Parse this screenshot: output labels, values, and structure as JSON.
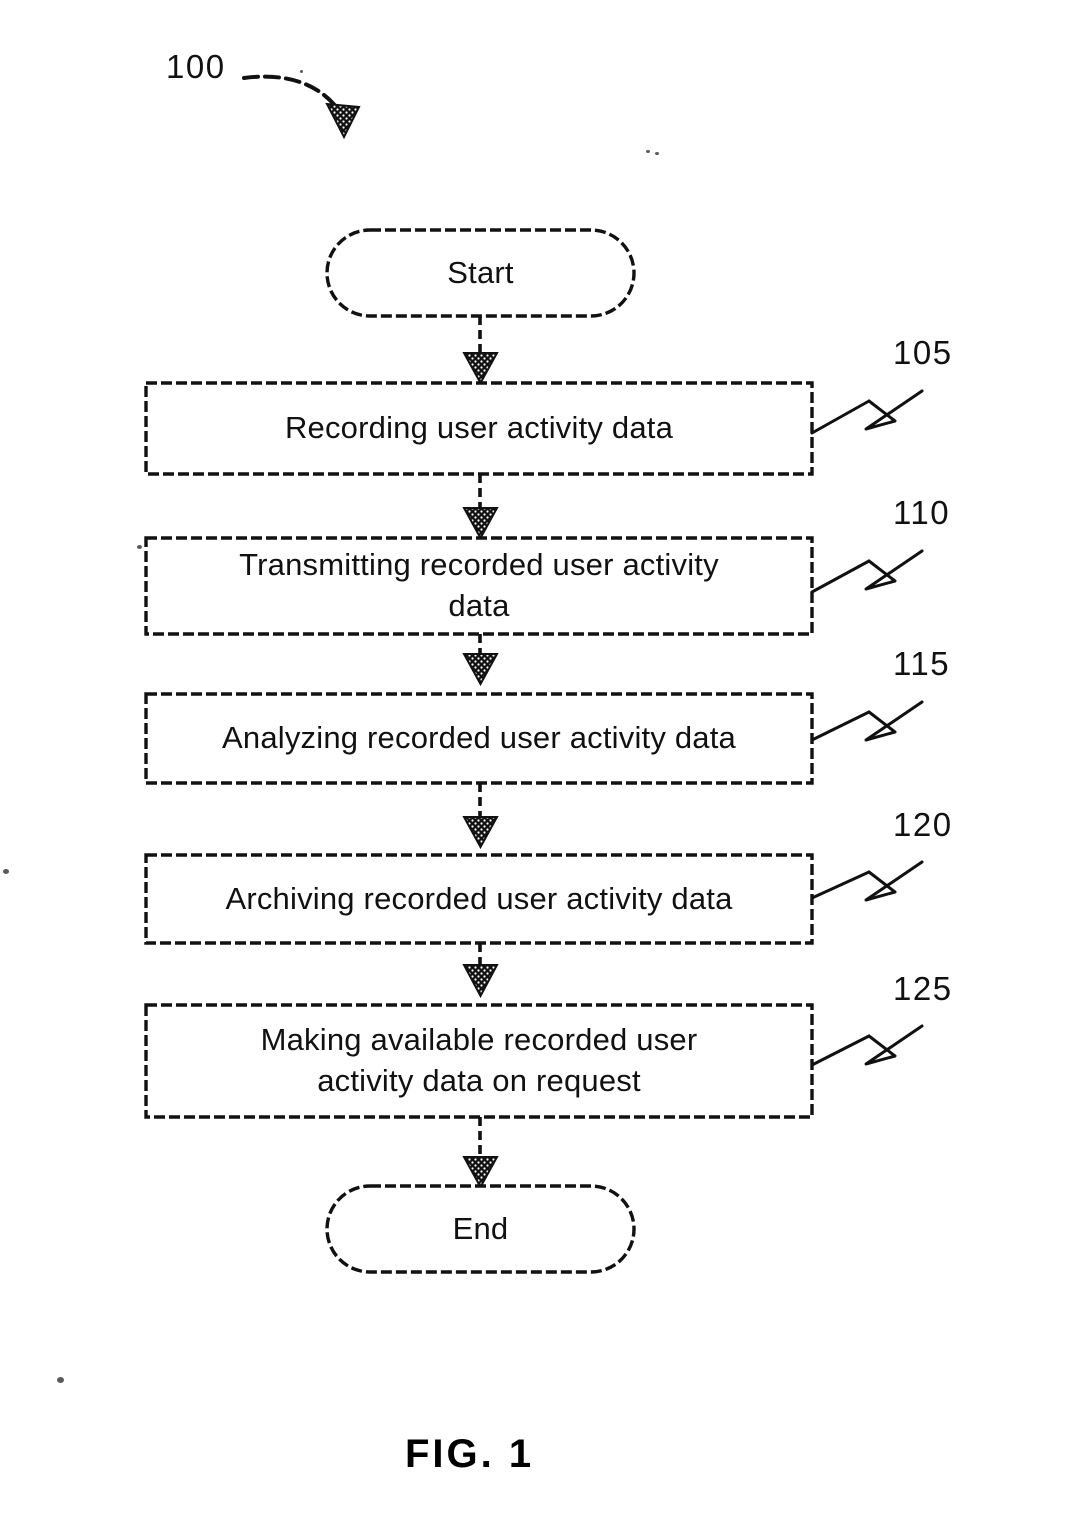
{
  "figure": {
    "caption": "FIG. 1",
    "diagram_reference": "100",
    "type": "flowchart"
  },
  "nodes": [
    {
      "id": "start",
      "shape": "terminal",
      "label": "Start",
      "ref": ""
    },
    {
      "id": "step105",
      "shape": "process",
      "label": "Recording user activity data",
      "ref": "105"
    },
    {
      "id": "step110",
      "shape": "process",
      "label": "Transmitting recorded user activity\ndata",
      "ref": "110"
    },
    {
      "id": "step115",
      "shape": "process",
      "label": "Analyzing recorded user activity data",
      "ref": "115"
    },
    {
      "id": "step120",
      "shape": "process",
      "label": "Archiving recorded user activity data",
      "ref": "120"
    },
    {
      "id": "step125",
      "shape": "process",
      "label": "Making available recorded user\nactivity data on request",
      "ref": "125"
    },
    {
      "id": "end",
      "shape": "terminal",
      "label": "End",
      "ref": ""
    }
  ],
  "reference_numerals": [
    {
      "value": "100",
      "points_to": "diagram"
    },
    {
      "value": "105",
      "points_to": "step105"
    },
    {
      "value": "110",
      "points_to": "step110"
    },
    {
      "value": "115",
      "points_to": "step115"
    },
    {
      "value": "120",
      "points_to": "step120"
    },
    {
      "value": "125",
      "points_to": "step125"
    }
  ],
  "edges": [
    {
      "from": "start",
      "to": "step105"
    },
    {
      "from": "step105",
      "to": "step110"
    },
    {
      "from": "step110",
      "to": "step115"
    },
    {
      "from": "step115",
      "to": "step120"
    },
    {
      "from": "step120",
      "to": "step125"
    },
    {
      "from": "step125",
      "to": "end"
    }
  ],
  "style": {
    "ink": "#111111",
    "background": "#ffffff"
  }
}
